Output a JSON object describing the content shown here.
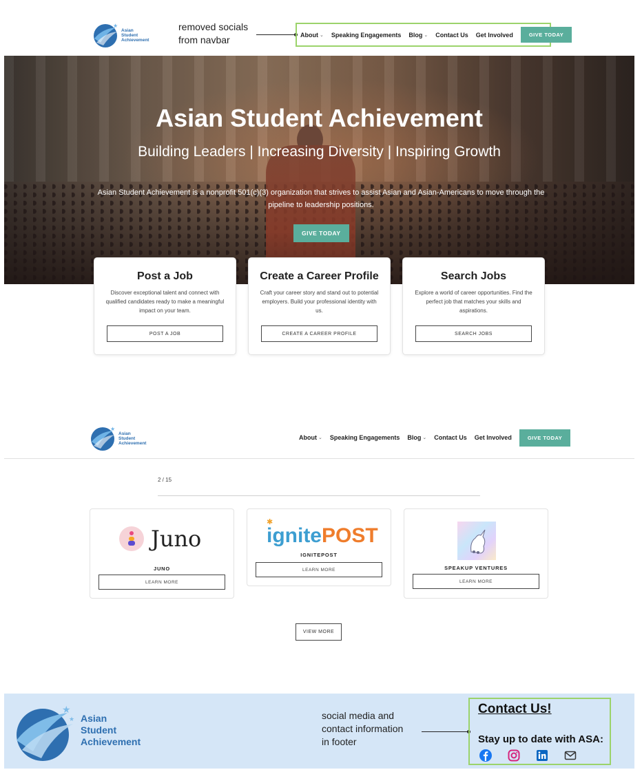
{
  "brand": {
    "line1": "Asian",
    "line2": "Student",
    "line3": "Achievement"
  },
  "nav": {
    "about": "About",
    "speaking": "Speaking Engagements",
    "blog": "Blog",
    "contact": "Contact Us",
    "involved": "Get Involved",
    "give": "GIVE TODAY"
  },
  "annotations": {
    "navbar": [
      "removed socials",
      "from navbar"
    ],
    "footer": [
      "social media and",
      "contact information",
      "in footer"
    ]
  },
  "hero": {
    "title": "Asian Student Achievement",
    "subtitle": "Building Leaders | Increasing Diversity | Inspiring Growth",
    "description": "Asian Student Achievement is a nonprofit 501(c)(3) organization that strives to assist Asian and Asian-Americans to move through the pipeline to leadership positions.",
    "button": "GIVE TODAY"
  },
  "cards": [
    {
      "title": "Post a Job",
      "text": "Discover exceptional talent and connect with qualified candidates ready to make a meaningful impact on your team.",
      "button": "POST A JOB"
    },
    {
      "title": "Create a Career Profile",
      "text": "Craft your career story and stand out to potential employers. Build your professional identity with us.",
      "button": "CREATE A CAREER PROFILE"
    },
    {
      "title": "Search Jobs",
      "text": "Explore a world of career opportunities. Find the perfect job that matches your skills and aspirations.",
      "button": "SEARCH JOBS"
    }
  ],
  "pager": "2 / 15",
  "partners": [
    {
      "logo": "Juno",
      "name": "JUNO",
      "button": "LEARN MORE"
    },
    {
      "logo_a": "ignite",
      "logo_b": "POST",
      "name": "IGNITEPOST",
      "button": "LEARN MORE"
    },
    {
      "name": "SPEAKUP VENTURES",
      "button": "LEARN MORE"
    }
  ],
  "view_more": "VIEW MORE",
  "footer": {
    "brand": [
      "Asian",
      "Student",
      "Achievement"
    ],
    "contact_title": "Contact Us!",
    "stay": "Stay up to date with ASA:",
    "social_icons": [
      "facebook-icon",
      "instagram-icon",
      "linkedin-icon",
      "mail-icon"
    ],
    "colors": {
      "facebook": "#1877f2",
      "instagram": "#d6247d",
      "linkedin": "#0a66c2",
      "mail": "#333333"
    }
  },
  "colors": {
    "accent": "#5aae9c",
    "brand_blue": "#2e6fb0",
    "annotation_box": "#9bd36a",
    "footer_bg": "#d5e6f7"
  }
}
